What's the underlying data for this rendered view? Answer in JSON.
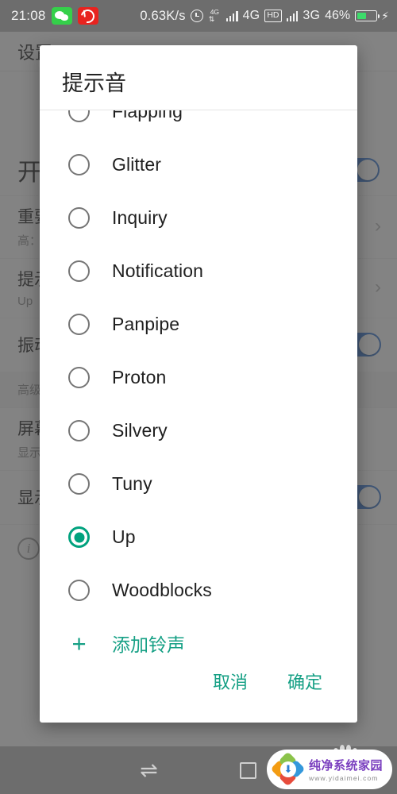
{
  "status_bar": {
    "clock": "21:08",
    "apps": [
      {
        "name": "wechat-badge",
        "label": ""
      },
      {
        "name": "netease-music-badge",
        "label": ""
      }
    ],
    "network_speed": "0.63K/s",
    "alarm_icon": "alarm-icon",
    "data_icon_label": "4G",
    "data_arrows": "⇅",
    "sim1_network": "4G",
    "hd_label": "HD",
    "sim2_network": "3G",
    "battery_percent": "46%",
    "charging_glyph": "⚡"
  },
  "background": {
    "header_title": "设置",
    "app_icon_name": "wechat-app-icon",
    "section_title": "开",
    "rows": [
      {
        "main": "重要",
        "sub": "高：",
        "control": "chevron"
      },
      {
        "main": "提示",
        "sub": "Up",
        "control": "chevron"
      },
      {
        "main": "振动",
        "sub": "",
        "control": "switch"
      }
    ],
    "advanced_section": "高级",
    "rows2": [
      {
        "main": "屏幕",
        "sub": "显示",
        "control": "none"
      },
      {
        "main": "显示",
        "sub": "",
        "control": "switch"
      }
    ],
    "footer_icon": "info-icon",
    "switch_color": "#3577d4"
  },
  "dialog": {
    "title": "提示音",
    "options": [
      {
        "label": "Flapping",
        "selected": false
      },
      {
        "label": "Glitter",
        "selected": false
      },
      {
        "label": "Inquiry",
        "selected": false
      },
      {
        "label": "Notification",
        "selected": false
      },
      {
        "label": "Panpipe",
        "selected": false
      },
      {
        "label": "Proton",
        "selected": false
      },
      {
        "label": "Silvery",
        "selected": false
      },
      {
        "label": "Tuny",
        "selected": false
      },
      {
        "label": "Up",
        "selected": true
      },
      {
        "label": "Woodblocks",
        "selected": false
      }
    ],
    "add_row": {
      "icon": "plus-icon",
      "icon_glyph": "+",
      "label": "添加铃声"
    },
    "cancel_label": "取消",
    "confirm_label": "确定",
    "accent_color": "#16a085",
    "selected_radio_color": "#00a27e"
  },
  "nav_bar": {
    "switch_glyph": "⇌",
    "recents_name": "recents-square-icon",
    "back_glyph": "‹"
  },
  "watermark": {
    "site_name": "纯净系统家园",
    "url": "www.yidaimei.com",
    "logo_glyph": "⬇"
  }
}
